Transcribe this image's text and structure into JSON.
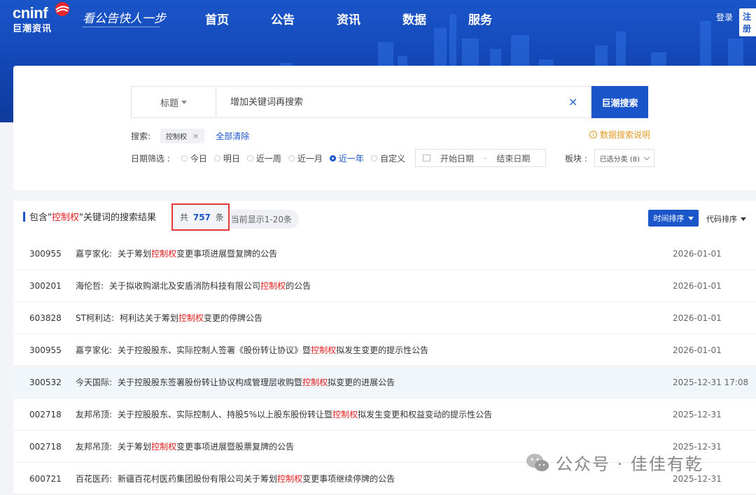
{
  "brand": {
    "logo": "cninf",
    "logo_cn": "巨潮资讯",
    "slogan": "看公告快人一步"
  },
  "nav": [
    "首页",
    "公告",
    "资讯",
    "数据",
    "服务"
  ],
  "auth": {
    "login": "登录",
    "register": "注册"
  },
  "search": {
    "field": "标题",
    "placeholder": "增加关键词再搜索",
    "clear": "×",
    "button": "巨潮搜索",
    "kw_label": "搜索:",
    "keyword": "控制权",
    "keyword_remove": "×",
    "clear_all": "全部清除",
    "help": "数据搜索说明",
    "date_label": "日期筛选 :",
    "date_options": [
      "今日",
      "明日",
      "近一周",
      "近一月",
      "近一年",
      "自定义"
    ],
    "date_active": "近一年",
    "start_date": "开始日期",
    "end_date": "结束日期",
    "date_sep": "-",
    "board_label": "板块 :",
    "board_value": "已选分类 (8)"
  },
  "results": {
    "head_prefix": "包含\"",
    "keyword": "控制权",
    "head_suffix": "\"关键词的搜索结果",
    "count_prefix": "共",
    "count": "757",
    "count_suffix": "条",
    "showing": "当前显示1-20条",
    "sort_time": "时间排序",
    "sort_code": "代码排序",
    "rows": [
      {
        "code": "300955",
        "name": "嘉亨家化:",
        "pre": "关于筹划",
        "hl": "控制权",
        "post": "变更事项进展暨复牌的公告",
        "date": "2026-01-01"
      },
      {
        "code": "300201",
        "name": "海伦哲:",
        "pre": "关于拟收购湖北及安盾消防科技有限公司",
        "hl": "控制权",
        "post": "的公告",
        "date": "2026-01-01"
      },
      {
        "code": "603828",
        "name": "ST柯利达:",
        "pre": "柯利达关于筹划",
        "hl": "控制权",
        "post": "变更的停牌公告",
        "date": "2026-01-01"
      },
      {
        "code": "300955",
        "name": "嘉亨家化:",
        "pre": "关于控股股东、实际控制人签署《股份转让协议》暨",
        "hl": "控制权",
        "post": "拟发生变更的提示性公告",
        "date": "2026-01-01"
      },
      {
        "code": "300532",
        "name": "今天国际:",
        "pre": "关于控股股东签署股份转让协议构成管理层收购暨",
        "hl": "控制权",
        "post": "拟变更的进展公告",
        "date": "2025-12-31 17:08"
      },
      {
        "code": "002718",
        "name": "友邦吊顶:",
        "pre": "关于控股股东、实际控制人、持股5%以上股东股份转让暨",
        "hl": "控制权",
        "post": "拟发生变更和权益变动的提示性公告",
        "date": "2025-12-31"
      },
      {
        "code": "002718",
        "name": "友邦吊顶:",
        "pre": "关于筹划",
        "hl": "控制权",
        "post": "变更事项进展暨股票复牌的公告",
        "date": "2025-12-31"
      },
      {
        "code": "600721",
        "name": "百花医药:",
        "pre": "新疆百花村医药集团股份有限公司关于筹划",
        "hl": "控制权",
        "post": "变更事项继续停牌的公告",
        "date": "2025-12-31"
      }
    ]
  },
  "watermark": "公众号 · 佳佳有乾",
  "colors": {
    "primary": "#1a56c9",
    "highlight": "#e02020",
    "warning": "#e39a2a"
  }
}
